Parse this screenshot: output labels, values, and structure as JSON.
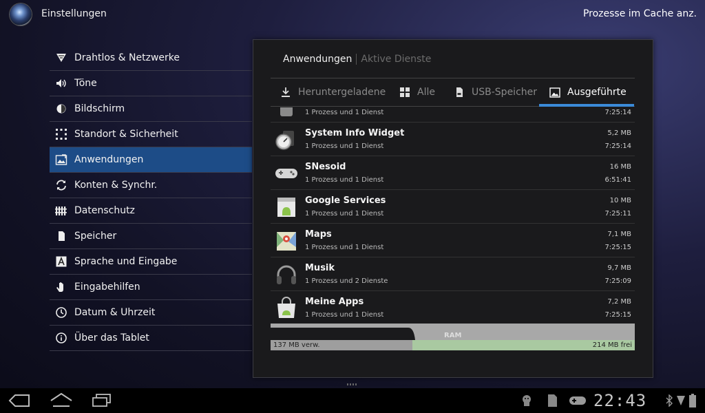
{
  "header": {
    "title": "Einstellungen",
    "action": "Prozesse im Cache anz."
  },
  "sidebar": {
    "items": [
      {
        "label": "Drahtlos & Netzwerke",
        "icon": "wifi-icon"
      },
      {
        "label": "Töne",
        "icon": "speaker-icon"
      },
      {
        "label": "Bildschirm",
        "icon": "brightness-icon"
      },
      {
        "label": "Standort & Sicherheit",
        "icon": "location-grid-icon"
      },
      {
        "label": "Anwendungen",
        "icon": "applications-icon",
        "active": true
      },
      {
        "label": "Konten & Synchr.",
        "icon": "sync-icon"
      },
      {
        "label": "Datenschutz",
        "icon": "privacy-fence-icon"
      },
      {
        "label": "Speicher",
        "icon": "sd-card-icon"
      },
      {
        "label": "Sprache und Eingabe",
        "icon": "keyboard-a-icon"
      },
      {
        "label": "Eingabehilfen",
        "icon": "hand-icon"
      },
      {
        "label": "Datum & Uhrzeit",
        "icon": "clock-icon"
      },
      {
        "label": "Über das Tablet",
        "icon": "info-icon"
      }
    ]
  },
  "panel": {
    "title": "Anwendungen",
    "title_secondary": "Aktive Dienste",
    "tabs": [
      {
        "label": "Heruntergeladene",
        "icon": "download-icon"
      },
      {
        "label": "Alle",
        "icon": "grid-icon"
      },
      {
        "label": "USB-Speicher",
        "icon": "sd-card-icon"
      },
      {
        "label": "Ausgeführte",
        "icon": "running-apps-icon",
        "active": true
      }
    ],
    "rows": [
      {
        "name": "",
        "sub": "1 Prozess und 1 Dienst",
        "size": "",
        "time": "7:25:14",
        "icon": "partial-app-icon"
      },
      {
        "name": "System Info Widget",
        "sub": "1 Prozess und 1 Dienst",
        "size": "5,2 MB",
        "time": "7:25:14",
        "icon": "gauge-icon"
      },
      {
        "name": "SNesoid",
        "sub": "1 Prozess und 1 Dienst",
        "size": "16 MB",
        "time": "6:51:41",
        "icon": "gamepad-icon"
      },
      {
        "name": "Google Services",
        "sub": "1 Prozess und 1 Dienst",
        "size": "10 MB",
        "time": "7:25:11",
        "icon": "android-box-icon"
      },
      {
        "name": "Maps",
        "sub": "1 Prozess und 1 Dienst",
        "size": "7,1 MB",
        "time": "7:25:15",
        "icon": "maps-icon"
      },
      {
        "name": "Musik",
        "sub": "1 Prozess und 2 Dienste",
        "size": "9,7 MB",
        "time": "7:25:09",
        "icon": "headphones-icon"
      },
      {
        "name": "Meine Apps",
        "sub": "1 Prozess und 1 Dienst",
        "size": "7,2 MB",
        "time": "7:25:15",
        "icon": "market-bag-icon"
      }
    ],
    "ram": {
      "label": "RAM",
      "used": "137 MB verw.",
      "free": "214 MB frei",
      "used_fraction": 0.39
    }
  },
  "system_bar": {
    "clock": "22:43"
  },
  "colors": {
    "accent": "#3b8ad8",
    "selected": "#1d4c87",
    "ram_used": "#9e9e9e",
    "ram_free": "#a9c9a1"
  }
}
